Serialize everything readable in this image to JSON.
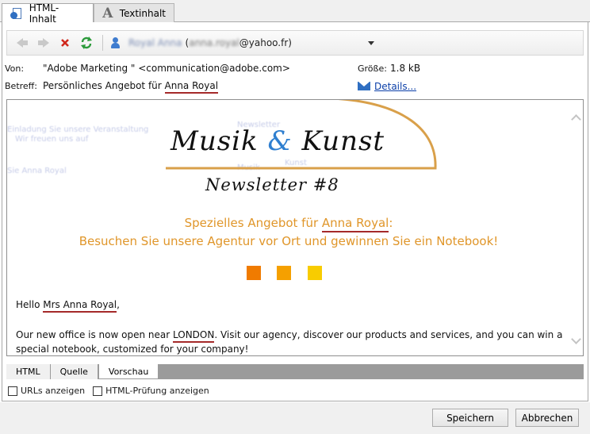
{
  "tabs": [
    {
      "label": "HTML-Inhalt",
      "icon": "html-content-icon",
      "active": true
    },
    {
      "label": "Textinhalt",
      "icon": "text-content-icon",
      "active": false
    }
  ],
  "toolbar": {
    "user_name": "Royal Anna",
    "user_paren_open": " (",
    "user_email_local": "anna.royal",
    "user_email_domain": "@yahoo.fr)"
  },
  "header": {
    "from_label": "Von:",
    "from_value": "\"Adobe Marketing \" <communication@adobe.com>",
    "subject_label": "Betreff:",
    "subject_prefix": "Persönliches Angebot für ",
    "subject_name": "Anna Royal",
    "size_label": "Größe:",
    "size_value": "1.8 kB",
    "details_link": "Details..."
  },
  "preview": {
    "logo_word1": "Musik ",
    "logo_amp": "&",
    "logo_word2": " Kunst",
    "newsletter": "Newsletter #8",
    "headline1_prefix": "Spezielles Angebot für ",
    "headline1_name": "Anna Royal",
    "headline1_suffix": ":",
    "headline2": "Besuchen Sie unsere Agentur vor Ort und gewinnen Sie ein Notebook!",
    "greeting_prefix": "Hello ",
    "greeting_name": "Mrs Anna Royal",
    "greeting_suffix": ",",
    "body1_prefix": "Our new office is now open near ",
    "body1_city": "LONDON",
    "body1_suffix": ". Visit our agency, discover our products and services, and you can win a",
    "body2": "special notebook, customized for your company!",
    "ghost_texts": [
      "Einladung Sie unsere Veranstaltung",
      "Wir freuen uns auf",
      "Sie Anna Royal",
      "Newsletter",
      "Musik",
      "Kunst"
    ],
    "colors": {
      "orange": "#f07b00",
      "amber": "#f5a000",
      "yellow": "#f8cc00",
      "headline": "#e0962a",
      "underline": "#a52a2a"
    }
  },
  "bottom_tabs": [
    {
      "label": "HTML",
      "active": false
    },
    {
      "label": "Quelle",
      "active": false
    },
    {
      "label": "Vorschau",
      "active": true
    }
  ],
  "checkboxes": [
    {
      "label": "URLs anzeigen",
      "checked": false
    },
    {
      "label": "HTML-Prüfung anzeigen",
      "checked": false
    }
  ],
  "footer": {
    "save": "Speichern",
    "cancel": "Abbrechen"
  }
}
